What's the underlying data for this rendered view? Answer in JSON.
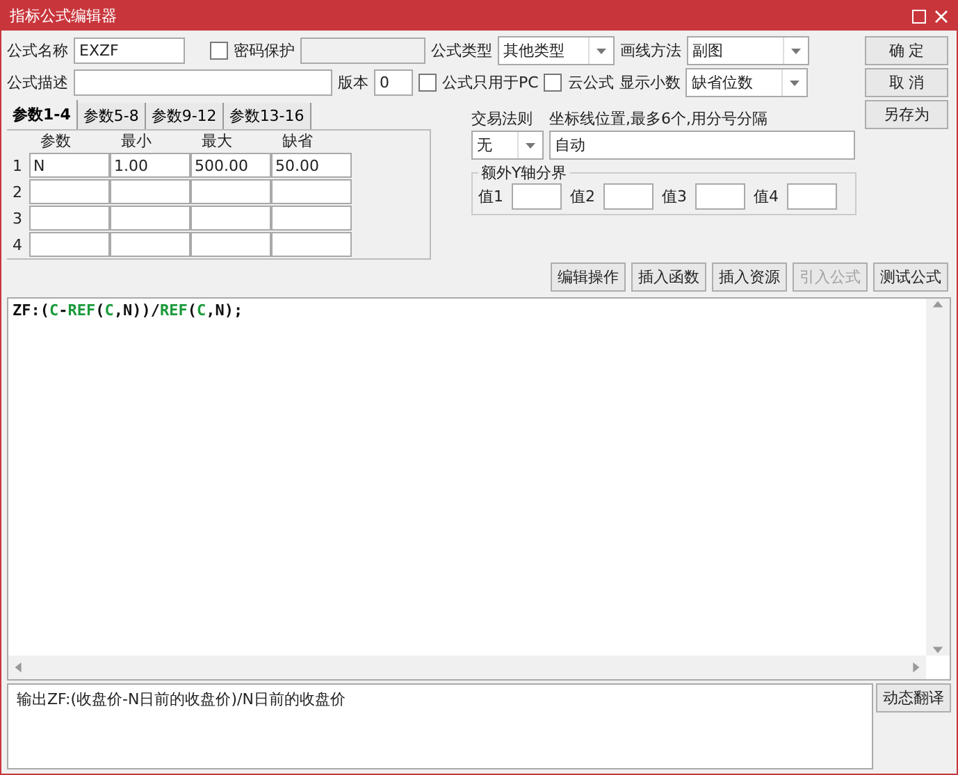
{
  "window": {
    "title": "指标公式编辑器"
  },
  "name_row": {
    "name_label": "公式名称",
    "name_value": "EXZF",
    "password": {
      "label": "密码保护",
      "checked": false
    },
    "type_label": "公式类型",
    "type_value": "其他类型",
    "draw_label": "画线方法",
    "draw_value": "副图"
  },
  "desc_row": {
    "desc_label": "公式描述",
    "version_label": "版本",
    "version_value": "0",
    "pc_only": {
      "label": "公式只用于PC",
      "checked": false
    },
    "cloud": {
      "label": "云公式",
      "checked": false
    },
    "decimals_label": "显示小数",
    "decimals_value": "缺省位数"
  },
  "side_buttons": [
    {
      "label": "确 定"
    },
    {
      "label": "取 消"
    },
    {
      "label": "另存为"
    }
  ],
  "param_tabs": [
    {
      "label": "参数1-4",
      "selected": true
    },
    {
      "label": "参数5-8",
      "selected": false
    },
    {
      "label": "参数9-12",
      "selected": false
    },
    {
      "label": "参数13-16",
      "selected": false
    }
  ],
  "param_table": {
    "columns": [
      "参数",
      "最小",
      "最大",
      "缺省"
    ],
    "rows": [
      {
        "index": "1",
        "cells": [
          "N",
          "1.00",
          "500.00",
          "50.00"
        ]
      },
      {
        "index": "2",
        "cells": [
          "",
          "",
          "",
          ""
        ]
      },
      {
        "index": "3",
        "cells": [
          "",
          "",
          "",
          ""
        ]
      },
      {
        "index": "4",
        "cells": [
          "",
          "",
          "",
          ""
        ]
      }
    ]
  },
  "trade_rule": {
    "label": "交易法则",
    "value": "无"
  },
  "axis": {
    "label": "坐标线位置,最多6个,用分号分隔",
    "value": "自动"
  },
  "y_bounds": {
    "title": "额外Y轴分界",
    "values": [
      {
        "label": "值1"
      },
      {
        "label": "值2"
      },
      {
        "label": "值3"
      },
      {
        "label": "值4"
      }
    ]
  },
  "action_buttons": [
    {
      "label": "编辑操作",
      "disabled": false
    },
    {
      "label": "插入函数",
      "disabled": false
    },
    {
      "label": "插入资源",
      "disabled": false
    },
    {
      "label": "引入公式",
      "disabled": true
    },
    {
      "label": "测试公式",
      "disabled": false
    }
  ],
  "code": [
    {
      "text": "ZF:(",
      "kind": "plain"
    },
    {
      "text": "C",
      "kind": "func"
    },
    {
      "text": "-",
      "kind": "plain"
    },
    {
      "text": "REF",
      "kind": "func"
    },
    {
      "text": "(",
      "kind": "plain"
    },
    {
      "text": "C",
      "kind": "func"
    },
    {
      "text": ",N))/",
      "kind": "plain"
    },
    {
      "text": "REF",
      "kind": "func"
    },
    {
      "text": "(",
      "kind": "plain"
    },
    {
      "text": "C",
      "kind": "func"
    },
    {
      "text": ",N);",
      "kind": "plain"
    }
  ],
  "description": {
    "text": "输出ZF:(收盘价-N日前的收盘价)/N日前的收盘价",
    "button": "动态翻译"
  }
}
